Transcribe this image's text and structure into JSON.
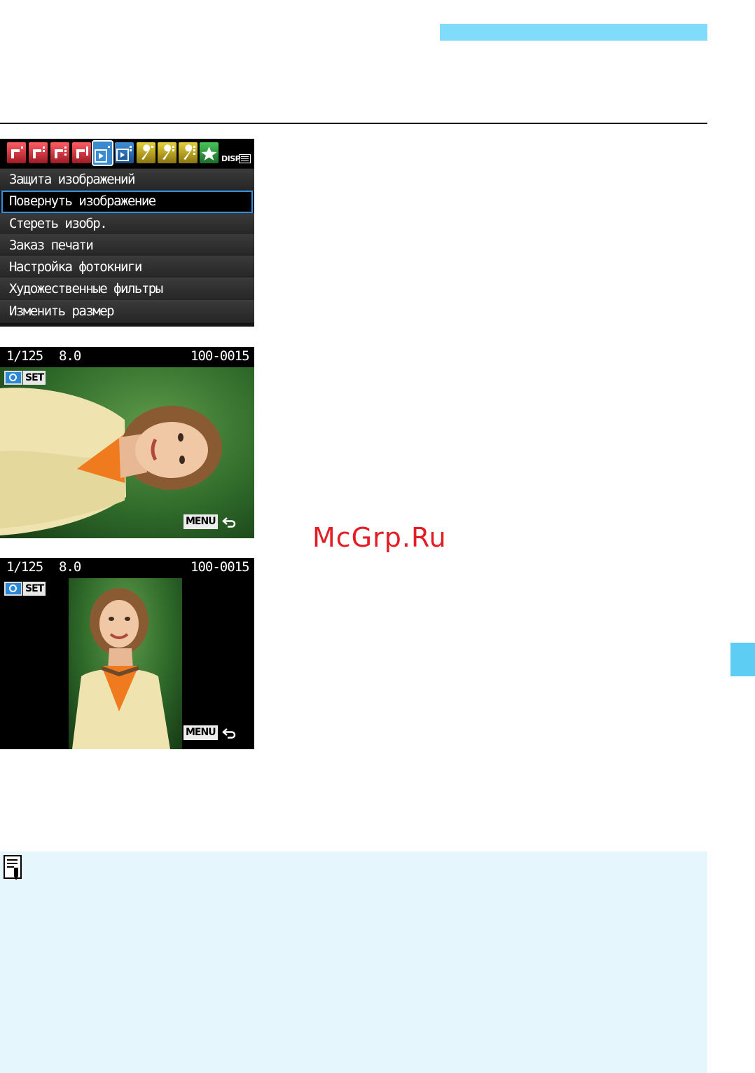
{
  "header": {
    "accent_color": "#80dcfa"
  },
  "menu_screen": {
    "tab_display_label": "DISP",
    "items": [
      {
        "label": "Защита изображений",
        "selected": false
      },
      {
        "label": "Повернуть изображение",
        "selected": true
      },
      {
        "label": "Стереть изобр.",
        "selected": false
      },
      {
        "label": "Заказ печати",
        "selected": false
      },
      {
        "label": "Настройка фотокниги",
        "selected": false
      },
      {
        "label": "Художественные фильтры",
        "selected": false
      },
      {
        "label": "Изменить размер",
        "selected": false
      }
    ],
    "selection_color": "#2f8ee0"
  },
  "playback_before": {
    "shutter": "1/125",
    "aperture": "8.0",
    "file_number": "100-0015",
    "set_label": "SET",
    "menu_label": "MENU",
    "q_icon": "quick-control-icon",
    "return_icon": "return-arrow-icon"
  },
  "playback_after": {
    "shutter": "1/125",
    "aperture": "8.0",
    "file_number": "100-0015",
    "set_label": "SET",
    "menu_label": "MENU",
    "q_icon": "quick-control-icon",
    "return_icon": "return-arrow-icon"
  },
  "watermark": {
    "text": "McGrp.Ru",
    "color": "#e51c23"
  },
  "note": {
    "icon": "memo-pencil-icon",
    "background": "#e5f6fd"
  },
  "side_tab": {
    "color": "#5ecdf3"
  }
}
